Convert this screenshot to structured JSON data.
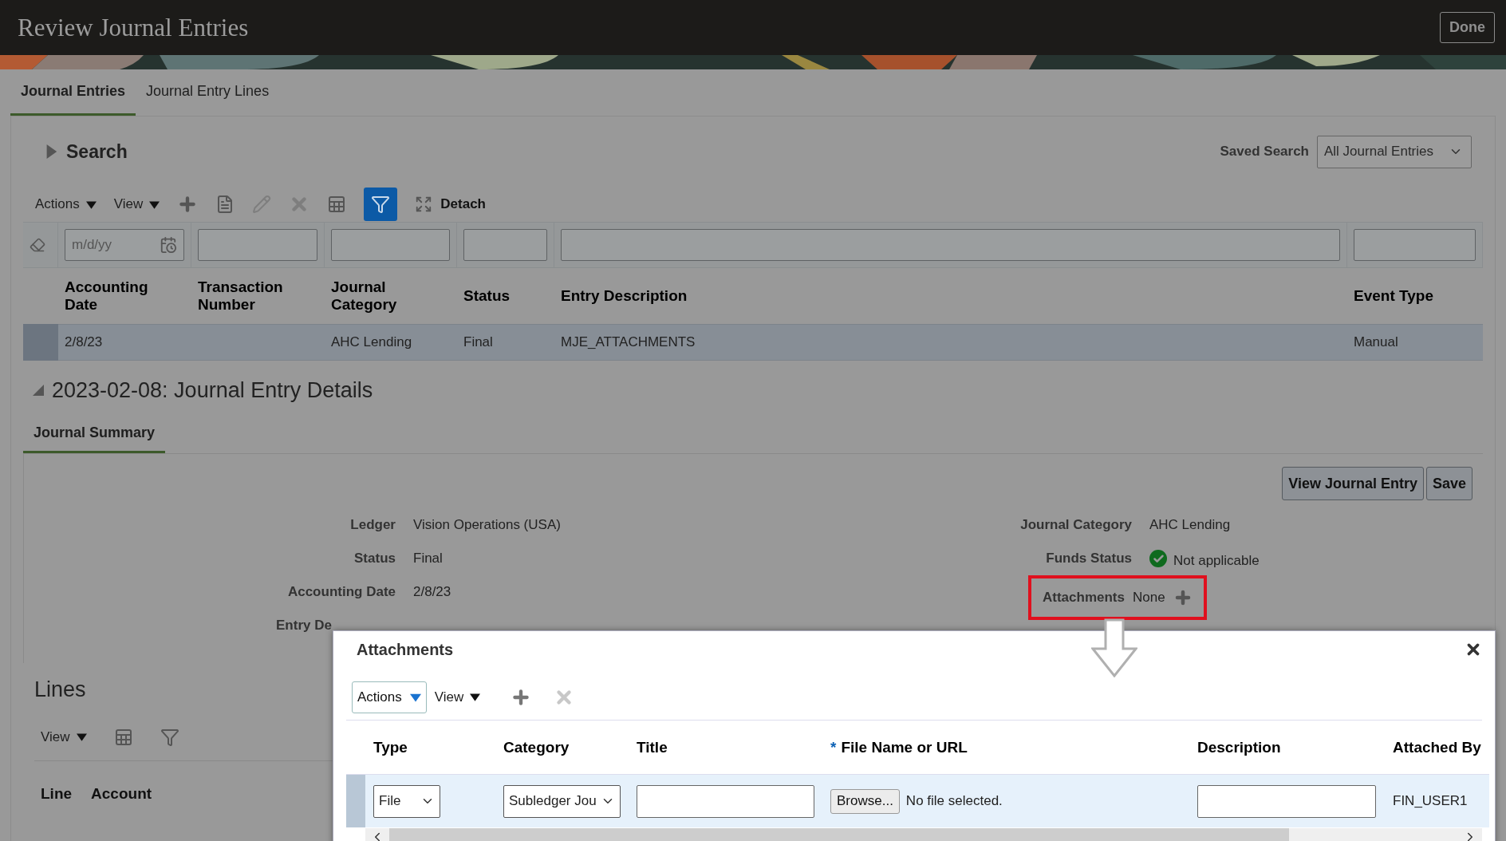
{
  "header": {
    "title": "Review Journal Entries",
    "done_button": "Done"
  },
  "tabs": [
    {
      "label": "Journal Entries",
      "selected": true
    },
    {
      "label": "Journal Entry Lines",
      "selected": false
    }
  ],
  "search": {
    "title": "Search",
    "expanded": false,
    "saved_search_label": "Saved Search",
    "saved_search_value": "All Journal Entries"
  },
  "toolbar": {
    "actions": "Actions",
    "view": "View",
    "detach": "Detach"
  },
  "filters": {
    "date_placeholder": "m/d/yy"
  },
  "table": {
    "columns": [
      "Accounting Date",
      "Transaction Number",
      "Journal Category",
      "Status",
      "Entry Description",
      "Event Type"
    ],
    "rows": [
      {
        "selected": true,
        "cells": [
          "2/8/23",
          "",
          "AHC Lending",
          "Final",
          "MJE_ATTACHMENTS",
          "Manual"
        ]
      }
    ]
  },
  "details": {
    "title": "2023-02-08: Journal Entry Details",
    "expanded": true,
    "tabs": [
      {
        "label": "Journal Summary",
        "selected": true
      }
    ],
    "buttons": [
      "View Journal Entry",
      "Save"
    ],
    "left_fields": [
      {
        "label": "Ledger",
        "value": "Vision Operations (USA)"
      },
      {
        "label": "Status",
        "value": "Final"
      },
      {
        "label": "Accounting Date",
        "value": "2/8/23"
      },
      {
        "kind": "cut",
        "label": "Entry De"
      }
    ],
    "right_fields": [
      {
        "kind": "text",
        "label": "Journal Category",
        "value": "AHC Lending"
      },
      {
        "kind": "status",
        "label": "Funds Status",
        "value": "Not applicable"
      },
      {
        "kind": "attachments",
        "label": "Attachments",
        "value": "None",
        "highlighted": true
      }
    ]
  },
  "lines": {
    "title": "Lines",
    "view": "View",
    "columns": [
      "Line",
      "Account"
    ]
  },
  "dialog": {
    "title": "Attachments",
    "actions": "Actions",
    "view": "View",
    "required_mark": "*",
    "columns": [
      {
        "label": "Type",
        "required": false
      },
      {
        "label": "Category",
        "required": false
      },
      {
        "label": "Title",
        "required": false
      },
      {
        "label": "File Name or URL",
        "required": true
      },
      {
        "label": "Description",
        "required": false
      },
      {
        "label": "Attached By",
        "required": false
      }
    ],
    "row": {
      "type": "File",
      "category": "Subledger Jou",
      "browse_button": "Browse...",
      "file_status": "No file selected.",
      "attached_by": "FIN_USER1"
    }
  }
}
